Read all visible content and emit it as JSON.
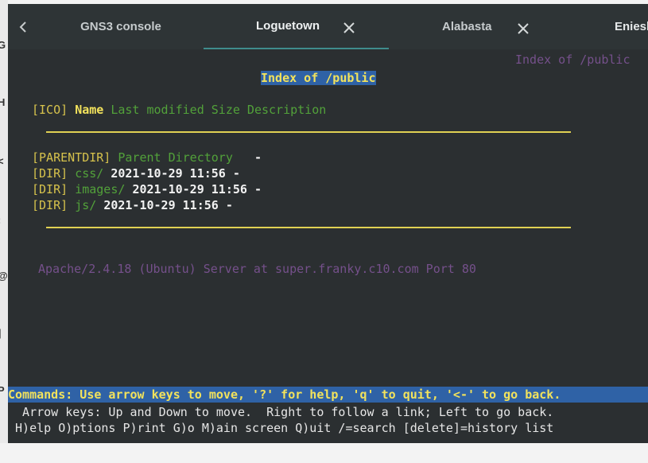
{
  "tabs": [
    {
      "label": "GNS3 console",
      "active": false,
      "closable": false
    },
    {
      "label": "Loguetown",
      "active": true,
      "closable": true
    },
    {
      "label": "Alabasta",
      "active": false,
      "closable": true
    },
    {
      "label": "Eniesl",
      "active": false,
      "closable": false
    }
  ],
  "icons": {
    "back": "chevron-left-icon",
    "close": "close-icon"
  },
  "left_strip_glyphs": [
    "G",
    "H",
    "<",
    ":",
    "@",
    "]",
    "P"
  ],
  "terminal": {
    "corner_title": "Index of /public",
    "page_title": "Index of /public",
    "header": {
      "ico": "[ICO]",
      "name": "Name",
      "rest": "Last modified Size Description"
    },
    "rows": [
      {
        "icon": "[PARENTDIR]",
        "name": "Parent Directory",
        "date": "",
        "size": "-"
      },
      {
        "icon": "[DIR]",
        "name": "css/",
        "date": "2021-10-29 11:56",
        "size": "-"
      },
      {
        "icon": "[DIR]",
        "name": "images/",
        "date": "2021-10-29 11:56",
        "size": "-"
      },
      {
        "icon": "[DIR]",
        "name": "js/",
        "date": "2021-10-29 11:56",
        "size": "-"
      }
    ],
    "footer": "Apache/2.4.18 (Ubuntu) Server at super.franky.c10.com Port 80",
    "commands_bar": "Commands: Use arrow keys to move, '?' for help, 'q' to quit, '<-' to go back.",
    "help_line_1": "  Arrow keys: Up and Down to move.  Right to follow a link; Left to go back.",
    "help_line_2": " H)elp O)ptions P)rint G)o M)ain screen Q)uit /=search [delete]=history list"
  },
  "colors": {
    "terminal_bg": "#2b2f31",
    "link_green": "#52a13a",
    "rule_yellow": "#e0d153",
    "highlight_blue": "#2f62a6",
    "footer_purple": "#75508b"
  }
}
